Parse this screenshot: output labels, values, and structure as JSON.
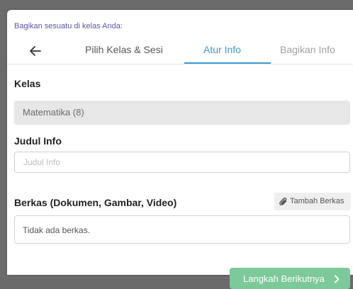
{
  "header": {
    "title": "Bagikan sesuatu di kelas Anda:",
    "back_icon": "arrow-left-icon",
    "tabs": [
      {
        "label": "Pilih Kelas & Sesi",
        "state": "done"
      },
      {
        "label": "Atur Info",
        "state": "active"
      },
      {
        "label": "Bagikan Info",
        "state": "upcoming"
      }
    ]
  },
  "form": {
    "kelas": {
      "label": "Kelas",
      "value": "Matematika (8)"
    },
    "judul": {
      "label": "Judul Info",
      "placeholder": "Judul Info",
      "value": ""
    },
    "berkas": {
      "label": "Berkas (Dokumen, Gambar, Video)",
      "add_button_label": "Tambah Berkas",
      "add_button_icon": "paperclip-icon",
      "empty_text": "Tidak ada berkas."
    }
  },
  "footer": {
    "next_button_label": "Langkah Berikutnya",
    "next_button_icon": "chevron-right-icon"
  },
  "colors": {
    "accent": "#3d9bd6",
    "title": "#5b54a8",
    "primary_button": "#7cc99a",
    "readonly_field": "#e7e7e7"
  }
}
